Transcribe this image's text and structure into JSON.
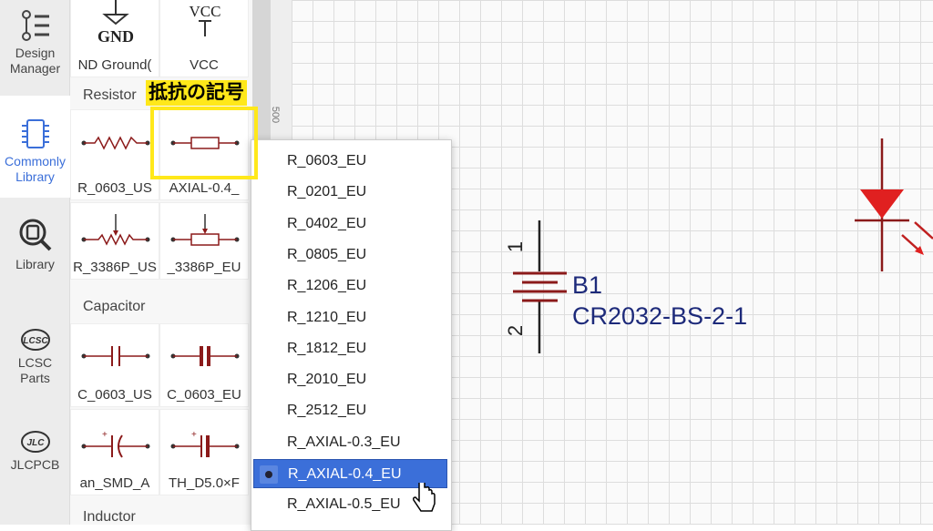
{
  "sidebar": {
    "items": [
      {
        "label1": "Design",
        "label2": "Manager",
        "icon": "design-manager-icon"
      },
      {
        "label1": "Commonly",
        "label2": "Library",
        "icon": "chip-icon",
        "active": true
      },
      {
        "label1": "Library",
        "label2": "",
        "icon": "library-search-icon"
      },
      {
        "label1": "LCSC",
        "label2": "Parts",
        "icon": "lcsc-logo-icon",
        "logo": "LCSC"
      },
      {
        "label1": "JLCPCB",
        "label2": "",
        "icon": "jlc-logo-icon",
        "logo": "JLC"
      }
    ]
  },
  "library": {
    "top": [
      {
        "label": "ND Ground(",
        "symbol": "GND"
      },
      {
        "label": "VCC",
        "symbol": "VCC"
      }
    ],
    "sections": [
      {
        "title": "Resistor",
        "rows": [
          [
            "R_0603_US",
            "AXIAL-0.4_"
          ],
          [
            "R_3386P_US",
            "_3386P_EU"
          ]
        ]
      },
      {
        "title": "Capacitor",
        "rows": [
          [
            "C_0603_US",
            "C_0603_EU"
          ],
          [
            "an_SMD_A",
            "TH_D5.0×F"
          ]
        ]
      },
      {
        "title": "Inductor"
      }
    ]
  },
  "ruler": {
    "mark": "500"
  },
  "annotation": {
    "label": "抵抗の記号",
    "color": "#ffe81a"
  },
  "dropdown": {
    "options": [
      "R_0603_EU",
      "R_0201_EU",
      "R_0402_EU",
      "R_0805_EU",
      "R_1206_EU",
      "R_1210_EU",
      "R_1812_EU",
      "R_2010_EU",
      "R_2512_EU",
      "R_AXIAL-0.3_EU",
      "R_AXIAL-0.4_EU",
      "R_AXIAL-0.5_EU"
    ],
    "selected": "R_AXIAL-0.4_EU",
    "accent": "#3b6fd9"
  },
  "schematic": {
    "designator": "B1",
    "value": "CR2032-BS-2-1",
    "pin1": "1",
    "pin2": "2",
    "wire_color": "#8b1a1a",
    "text_color": "#1d2a7a",
    "led_color": "#e02020"
  }
}
